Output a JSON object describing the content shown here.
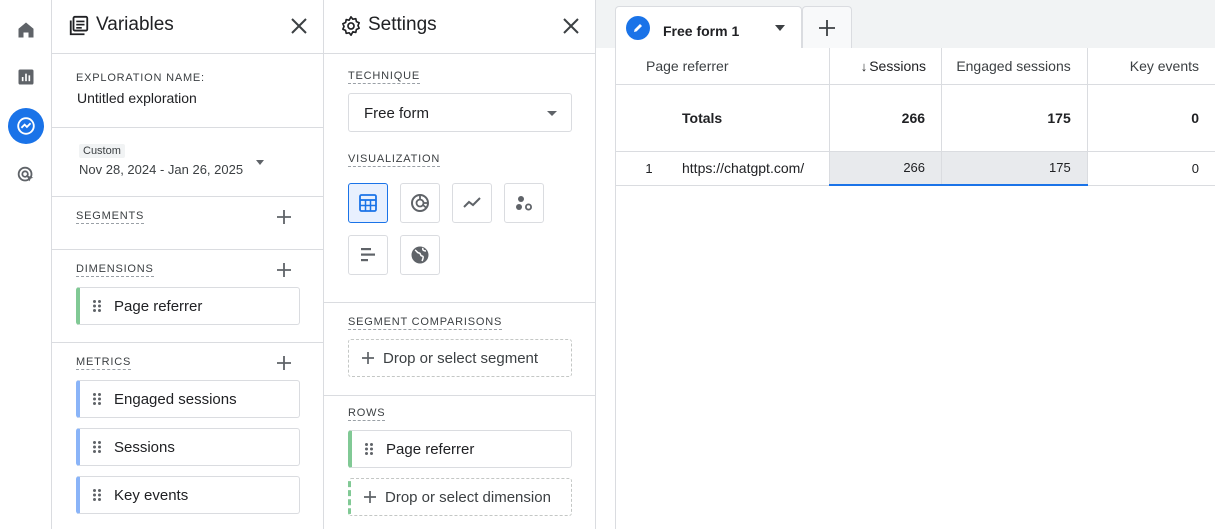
{
  "rail": {
    "items": [
      "home-icon",
      "reports-icon",
      "explore-icon",
      "advertising-icon"
    ]
  },
  "variables": {
    "title": "Variables",
    "exploration_name_label": "EXPLORATION NAME:",
    "exploration_name": "Untitled exploration",
    "date_badge": "Custom",
    "date_range": "Nov 28, 2024 - Jan 26, 2025",
    "segments_label": "SEGMENTS",
    "dimensions_label": "DIMENSIONS",
    "dimensions": [
      "Page referrer"
    ],
    "metrics_label": "METRICS",
    "metrics": [
      "Engaged sessions",
      "Sessions",
      "Key events"
    ]
  },
  "settings": {
    "title": "Settings",
    "technique_label": "TECHNIQUE",
    "technique_value": "Free form",
    "visualization_label": "VISUALIZATION",
    "visualization_options": [
      "table-icon",
      "donut-chart-icon",
      "line-chart-icon",
      "scatter-plot-icon",
      "bar-chart-icon",
      "geo-map-icon"
    ],
    "selected_visualization": "table-icon",
    "segment_comparisons_label": "SEGMENT COMPARISONS",
    "segment_drop": "Drop or select segment",
    "rows_label": "ROWS",
    "rows": [
      "Page referrer"
    ],
    "rows_drop": "Drop or select dimension"
  },
  "canvas": {
    "tab_name": "Free form 1",
    "columns": [
      "Page referrer",
      "Sessions",
      "Engaged sessions",
      "Key events"
    ],
    "sort_indicator": "↓",
    "totals_label": "Totals",
    "totals": [
      "266",
      "175",
      "0"
    ],
    "rows": [
      {
        "index": "1",
        "referrer": "https://chatgpt.com/",
        "sessions": "266",
        "engaged": "175",
        "key_events": "0"
      }
    ],
    "colors": {
      "accent": "#1a73e8",
      "dimension_accent": "#81c995",
      "metric_accent": "#8ab4f8"
    }
  }
}
